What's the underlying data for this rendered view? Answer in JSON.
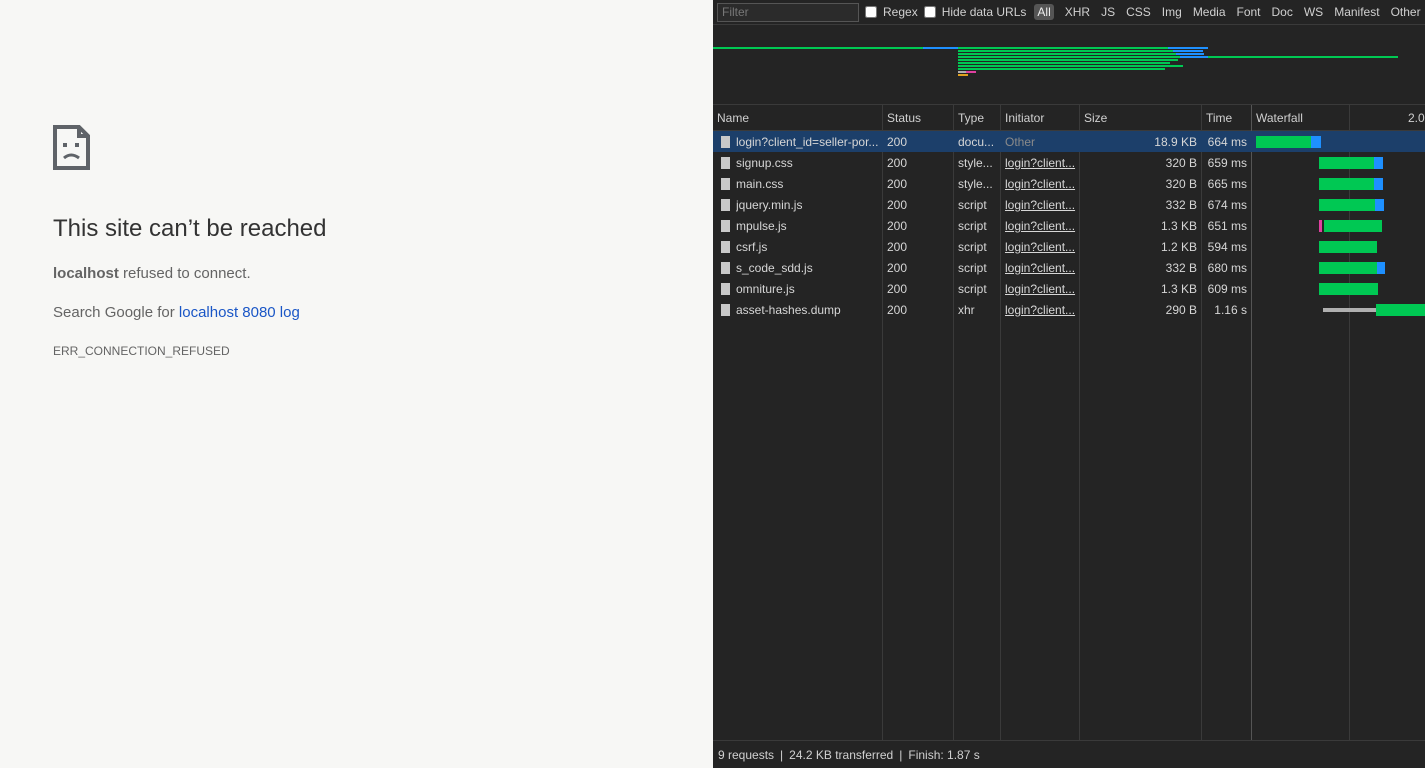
{
  "error_page": {
    "title": "This site can’t be reached",
    "host": "localhost",
    "detail_rest": " refused to connect.",
    "suggest_prefix": "Search Google for ",
    "suggest_link": "localhost 8080 log",
    "error_code": "ERR_CONNECTION_REFUSED"
  },
  "devtools": {
    "filter_placeholder": "Filter",
    "regex_label": "Regex",
    "hide_data_urls_label": "Hide data URLs",
    "type_filters": [
      "All",
      "XHR",
      "JS",
      "CSS",
      "Img",
      "Media",
      "Font",
      "Doc",
      "WS",
      "Manifest",
      "Other"
    ],
    "active_filter": "All",
    "columns": {
      "name": "Name",
      "status": "Status",
      "type": "Type",
      "initiator": "Initiator",
      "size": "Size",
      "time": "Time",
      "waterfall": "Waterfall",
      "waterfall_tick": "2.0"
    },
    "requests": [
      {
        "name": "login?client_id=seller-por...",
        "status": "200",
        "type": "docu...",
        "initiator": "Other",
        "size": "18.9 KB",
        "time": "664 ms"
      },
      {
        "name": "signup.css",
        "status": "200",
        "type": "style...",
        "initiator": "login?client...",
        "size": "320 B",
        "time": "659 ms"
      },
      {
        "name": "main.css",
        "status": "200",
        "type": "style...",
        "initiator": "login?client...",
        "size": "320 B",
        "time": "665 ms"
      },
      {
        "name": "jquery.min.js",
        "status": "200",
        "type": "script",
        "initiator": "login?client...",
        "size": "332 B",
        "time": "674 ms"
      },
      {
        "name": "mpulse.js",
        "status": "200",
        "type": "script",
        "initiator": "login?client...",
        "size": "1.3 KB",
        "time": "651 ms"
      },
      {
        "name": "csrf.js",
        "status": "200",
        "type": "script",
        "initiator": "login?client...",
        "size": "1.2 KB",
        "time": "594 ms"
      },
      {
        "name": "s_code_sdd.js",
        "status": "200",
        "type": "script",
        "initiator": "login?client...",
        "size": "332 B",
        "time": "680 ms"
      },
      {
        "name": "omniture.js",
        "status": "200",
        "type": "script",
        "initiator": "login?client...",
        "size": "1.3 KB",
        "time": "609 ms"
      },
      {
        "name": "asset-hashes.dump",
        "status": "200",
        "type": "xhr",
        "initiator": "login?client...",
        "size": "290 B",
        "time": "1.16 s"
      }
    ],
    "summary": {
      "requests": "9 requests",
      "transferred": "24.2 KB transferred",
      "finish": "Finish: 1.87 s",
      "separator": "|"
    },
    "colors": {
      "waiting": "#00c853",
      "download": "#1e90ff",
      "queued": "#b0b0b0",
      "selected_row": "#1c3f6a"
    }
  }
}
